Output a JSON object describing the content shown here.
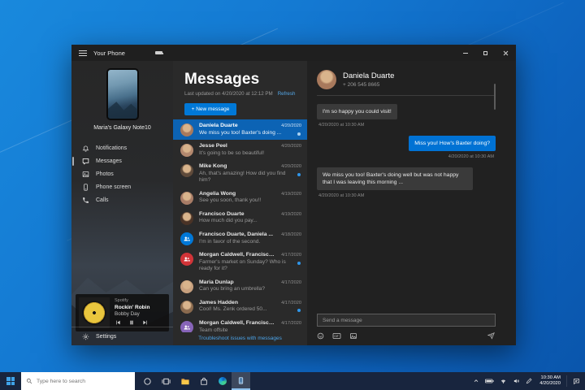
{
  "window": {
    "title": "Your Phone"
  },
  "sidebar": {
    "device_name": "Maria's Galaxy Note10",
    "nav": [
      {
        "label": "Notifications",
        "selected": false
      },
      {
        "label": "Messages",
        "selected": true
      },
      {
        "label": "Photos",
        "selected": false
      },
      {
        "label": "Phone screen",
        "selected": false
      },
      {
        "label": "Calls",
        "selected": false
      }
    ],
    "player": {
      "service": "Spotify",
      "track": "Rockin' Robin",
      "artist": "Bobby Day"
    },
    "settings_label": "Settings"
  },
  "messages_pane": {
    "title": "Messages",
    "last_updated": "Last updated on 4/20/2020 at 12:12 PM",
    "refresh_label": "Refresh",
    "new_message_label": "+ New message",
    "troubleshoot_label": "Troubleshoot issues with messages",
    "conversations": [
      {
        "name": "Daniela Duarte",
        "date": "4/20/2020",
        "preview": "We miss you too! Baxter's doing ...",
        "selected": true,
        "unread": true,
        "avatar": {
          "type": "photo",
          "color": "#a8795c"
        }
      },
      {
        "name": "Jesse Peel",
        "date": "4/20/2020",
        "preview": "It's going to be so beautiful!",
        "selected": false,
        "unread": false,
        "avatar": {
          "type": "photo",
          "color": "#b3886e"
        }
      },
      {
        "name": "Mike Kong",
        "date": "4/20/2020",
        "preview": "Ah, that's amazing! How did you find him?",
        "selected": false,
        "unread": true,
        "avatar": {
          "type": "photo",
          "color": "#5f4a3a"
        }
      },
      {
        "name": "Angelia Wong",
        "date": "4/19/2020",
        "preview": "See you soon, thank you!!",
        "selected": false,
        "unread": false,
        "avatar": {
          "type": "photo",
          "color": "#a87c66"
        }
      },
      {
        "name": "Francisco Duarte",
        "date": "4/19/2020",
        "preview": "How much did you pay...",
        "selected": false,
        "unread": false,
        "avatar": {
          "type": "photo",
          "color": "#4a3326"
        }
      },
      {
        "name": "Francisco Duarte, Daniela ...",
        "date": "4/18/2020",
        "preview": "I'm in favor of the second.",
        "selected": false,
        "unread": false,
        "avatar": {
          "type": "group",
          "color": "#0078d7"
        }
      },
      {
        "name": "Morgan Caldwell, Francisco ...",
        "date": "4/17/2020",
        "preview": "Farmer's market on Sunday? Who is ready for it?",
        "selected": false,
        "unread": true,
        "avatar": {
          "type": "group",
          "color": "#d13438"
        }
      },
      {
        "name": "Maria Dunlap",
        "date": "4/17/2020",
        "preview": "Can you bring an umbrella?",
        "selected": false,
        "unread": false,
        "avatar": {
          "type": "photo",
          "color": "#c7a07e"
        }
      },
      {
        "name": "James Hadden",
        "date": "4/17/2020",
        "preview": "Cool! Ms. Zenk ordered 50...",
        "selected": false,
        "unread": true,
        "avatar": {
          "type": "photo",
          "color": "#8a6a4e"
        }
      },
      {
        "name": "Morgan Caldwell, Francisco ...",
        "date": "4/17/2020",
        "preview": "Team offsite",
        "selected": false,
        "unread": false,
        "avatar": {
          "type": "group",
          "color": "#8764b8"
        }
      }
    ]
  },
  "conversation": {
    "contact_name": "Daniela Duarte",
    "contact_number": "+ 206 545 8665",
    "contact_avatar_color": "#a8795c",
    "messages": [
      {
        "direction": "in",
        "text": "I'm so happy you could visit!",
        "timestamp": "4/20/2020 at 10:30 AM"
      },
      {
        "direction": "out",
        "text": "Miss you! How's Baxter doing?",
        "timestamp": "4/20/2020 at 10:30 AM"
      },
      {
        "direction": "in",
        "text": "We miss you too! Baxter's doing well but was not happy that I was leaving this morning ...",
        "timestamp": "4/20/2020 at 10:30 AM"
      }
    ],
    "composer": {
      "placeholder": "Send a message"
    }
  },
  "taskbar": {
    "search_placeholder": "Type here to search",
    "clock": {
      "time": "10:30 AM",
      "date": "4/20/2020"
    }
  },
  "colors": {
    "accent": "#0078d7",
    "selected_row": "#0c63b4",
    "unread_dot": "#2f96ea",
    "link": "#4ba3e8",
    "group_blue": "#0078d7",
    "group_red": "#d13438",
    "group_purple": "#8764b8"
  }
}
